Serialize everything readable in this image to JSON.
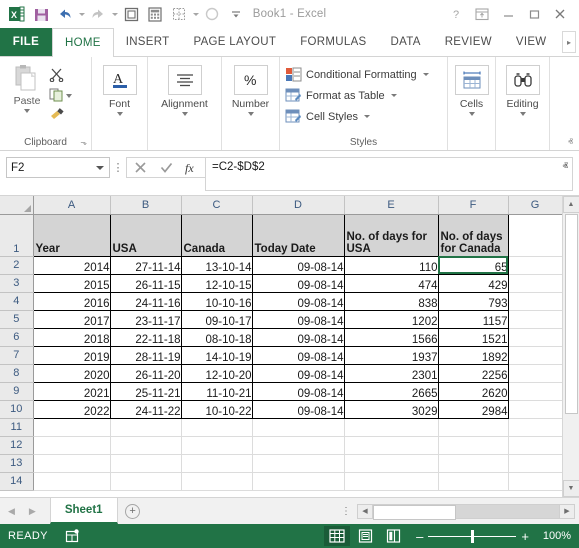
{
  "titlebar": {
    "app_title": "Book1 - Excel",
    "quick_access": [
      {
        "name": "excel-logo-icon",
        "label": "Excel"
      },
      {
        "name": "save-icon",
        "label": "Save"
      },
      {
        "name": "undo-icon",
        "label": "Undo"
      },
      {
        "name": "redo-icon",
        "label": "Redo"
      },
      {
        "name": "print-preview-icon",
        "label": "Print Preview and Print"
      },
      {
        "name": "calculator-icon",
        "label": "Calculator"
      },
      {
        "name": "borders-icon",
        "label": "Borders"
      },
      {
        "name": "fill-color-icon",
        "label": "Fill Color"
      },
      {
        "name": "customize-quick-access-toolbar-icon",
        "label": "Customize Quick Access Toolbar"
      }
    ],
    "window_controls": [
      {
        "name": "help-button",
        "glyph": "?"
      },
      {
        "name": "ribbon-display-options-button",
        "glyph": "⬒"
      },
      {
        "name": "minimize-button",
        "glyph": "–"
      },
      {
        "name": "restore-button",
        "glyph": "⬜"
      },
      {
        "name": "close-button",
        "glyph": "✕"
      }
    ]
  },
  "ribbon": {
    "file_tab": "FILE",
    "tabs": [
      {
        "label": "HOME",
        "active": true
      },
      {
        "label": "INSERT",
        "active": false
      },
      {
        "label": "PAGE LAYOUT",
        "active": false
      },
      {
        "label": "FORMULAS",
        "active": false
      },
      {
        "label": "DATA",
        "active": false
      },
      {
        "label": "REVIEW",
        "active": false
      },
      {
        "label": "VIEW",
        "active": false
      }
    ],
    "tab_overflow_glyph": "▸",
    "groups": {
      "clipboard": {
        "label": "Clipboard",
        "paste_label": "Paste",
        "cut_label": "Cut",
        "copy_label": "Copy",
        "format_painter_label": "Format Painter",
        "dialog_launcher": "⬎"
      },
      "font": {
        "label": "Font"
      },
      "alignment": {
        "label": "Alignment"
      },
      "number": {
        "label": "Number"
      },
      "styles": {
        "label": "Styles",
        "items": [
          {
            "label": "Conditional Formatting",
            "has_dropdown": true
          },
          {
            "label": "Format as Table",
            "has_dropdown": true
          },
          {
            "label": "Cell Styles",
            "has_dropdown": true
          }
        ]
      },
      "cells": {
        "label": "Cells"
      },
      "editing": {
        "label": "Editing"
      }
    },
    "collapse_glyph": "ⱏ"
  },
  "formula_bar": {
    "name_box_value": "F2",
    "cancel_glyph": "✕",
    "enter_glyph": "✓",
    "function_glyph": "fx",
    "formula_value": "=C2-$D$2",
    "expand_glyph": "ⱏ"
  },
  "grid": {
    "column_headers": [
      "A",
      "B",
      "C",
      "D",
      "E",
      "F",
      "G"
    ],
    "row_headers": [
      "1",
      "2",
      "3",
      "4",
      "5",
      "6",
      "7",
      "8",
      "9",
      "10",
      "11",
      "12",
      "13",
      "14"
    ],
    "selected_cell": "F2",
    "header_row": [
      "Year",
      "USA",
      "Canada",
      "Today Date",
      "No. of days for USA",
      "No. of days for Canada"
    ],
    "rows": [
      {
        "row": "2",
        "cells": [
          "2014",
          "27-11-14",
          "13-10-14",
          "09-08-14",
          "110",
          "65"
        ]
      },
      {
        "row": "3",
        "cells": [
          "2015",
          "26-11-15",
          "12-10-15",
          "09-08-14",
          "474",
          "429"
        ]
      },
      {
        "row": "4",
        "cells": [
          "2016",
          "24-11-16",
          "10-10-16",
          "09-08-14",
          "838",
          "793"
        ]
      },
      {
        "row": "5",
        "cells": [
          "2017",
          "23-11-17",
          "09-10-17",
          "09-08-14",
          "1202",
          "1157"
        ]
      },
      {
        "row": "6",
        "cells": [
          "2018",
          "22-11-18",
          "08-10-18",
          "09-08-14",
          "1566",
          "1521"
        ]
      },
      {
        "row": "7",
        "cells": [
          "2019",
          "28-11-19",
          "14-10-19",
          "09-08-14",
          "1937",
          "1892"
        ]
      },
      {
        "row": "8",
        "cells": [
          "2020",
          "26-11-20",
          "12-10-20",
          "09-08-14",
          "2301",
          "2256"
        ]
      },
      {
        "row": "9",
        "cells": [
          "2021",
          "25-11-21",
          "11-10-21",
          "09-08-14",
          "2665",
          "2620"
        ]
      },
      {
        "row": "10",
        "cells": [
          "2022",
          "24-11-22",
          "10-10-22",
          "09-08-14",
          "3029",
          "2984"
        ]
      }
    ],
    "empty_rows": [
      "11",
      "12",
      "13",
      "14"
    ],
    "scroll_up_glyph": "▲",
    "scroll_down_glyph": "▼"
  },
  "sheet_bar": {
    "prev_glyph": "◀",
    "next_glyph": "▶",
    "tabs": [
      {
        "label": "Sheet1",
        "active": true
      }
    ],
    "add_sheet_glyph": "+",
    "more_glyph": "⋮",
    "hscroll_left_glyph": "◀",
    "hscroll_right_glyph": "▶"
  },
  "status_bar": {
    "status_text": "READY",
    "macro_record_icon": "record-macro-icon",
    "views": [
      {
        "name": "normal-view-button",
        "label": "Normal",
        "active": true
      },
      {
        "name": "page-layout-view-button",
        "label": "Page Layout",
        "active": false
      },
      {
        "name": "page-break-preview-button",
        "label": "Page Break Preview",
        "active": false
      }
    ],
    "zoom_out_glyph": "–",
    "zoom_in_glyph": "+",
    "zoom_level": "100%"
  },
  "colors": {
    "excel_green": "#217346",
    "ribbon_bg": "#ffffff",
    "grid_header_bg": "#eaeaea",
    "table_header_fill": "#d4d4d4"
  }
}
